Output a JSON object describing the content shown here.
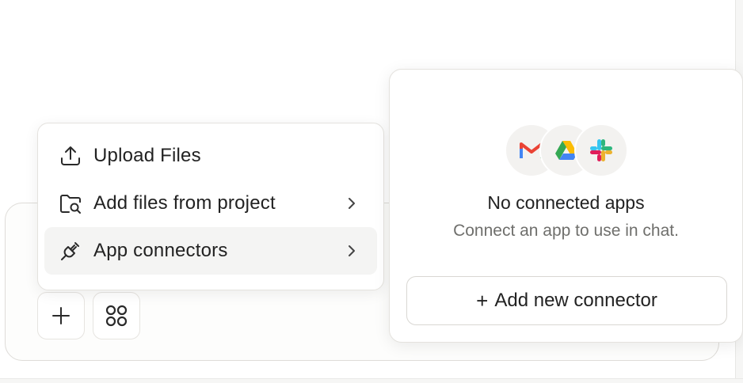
{
  "attach_menu": {
    "items": [
      {
        "label": "Upload Files",
        "icon": "upload-icon",
        "has_submenu": false
      },
      {
        "label": "Add files from project",
        "icon": "folder-search-icon",
        "has_submenu": true
      },
      {
        "label": "App connectors",
        "icon": "plug-icon",
        "has_submenu": true,
        "active": true
      }
    ]
  },
  "composer": {
    "buttons": [
      {
        "icon": "plus-icon"
      },
      {
        "icon": "tools-grid-icon"
      }
    ]
  },
  "connectors": {
    "logos": [
      "gmail-icon",
      "google-drive-icon",
      "slack-icon"
    ],
    "title": "No connected apps",
    "subtitle": "Connect an app to use in chat.",
    "add_button_label": "Add new connector",
    "add_button_glyph": "+"
  },
  "colors": {
    "active_item_bg": "#f4f4f3",
    "border": "#e4e2de",
    "muted_text": "#6f6f6c"
  }
}
